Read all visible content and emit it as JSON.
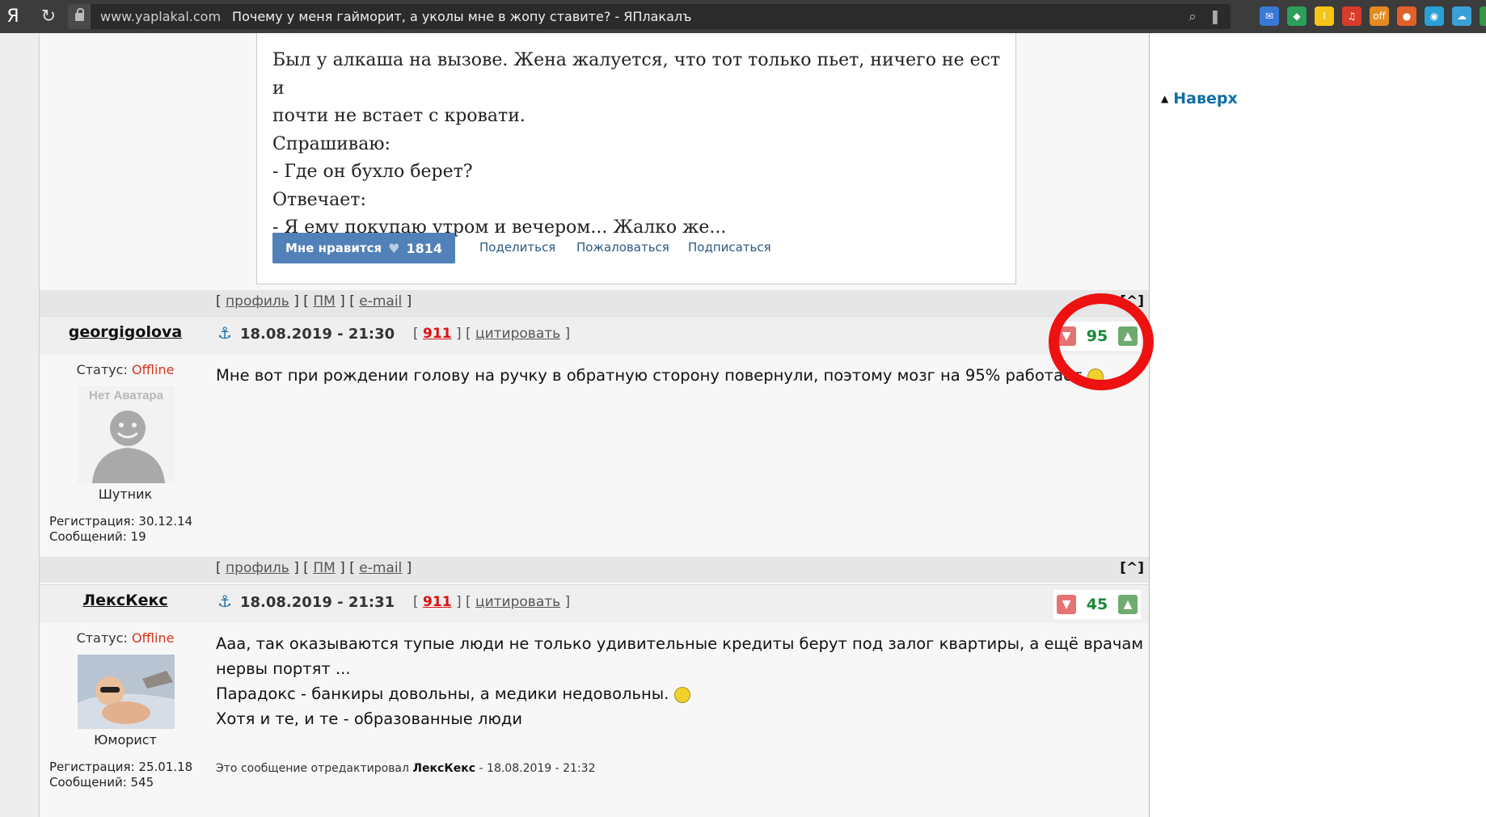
{
  "browser": {
    "logo": "Я",
    "reload_icon": "↻",
    "domain": "www.yaplakal.com",
    "title": "Почему у меня гайморит, а уколы мне в жопу ставите? - ЯПлакалъ",
    "extensions": [
      {
        "name": "mail-extension-icon",
        "color": "#3a78d8",
        "glyph": "✉"
      },
      {
        "name": "shield-extension-icon",
        "color": "#2c9f5a",
        "glyph": "◆"
      },
      {
        "name": "yellow-extension-icon",
        "color": "#f5c518",
        "glyph": "I"
      },
      {
        "name": "music-extension-icon",
        "color": "#d93b2b",
        "glyph": "♫"
      },
      {
        "name": "offer-extension-icon",
        "color": "#e58a1f",
        "glyph": "off"
      },
      {
        "name": "pin-extension-icon",
        "color": "#e0612a",
        "glyph": "●"
      },
      {
        "name": "bug-extension-icon",
        "color": "#2a9fd8",
        "glyph": "◉"
      },
      {
        "name": "cloud-extension-icon",
        "color": "#3aa0d8",
        "glyph": "☁"
      },
      {
        "name": "download-extension-icon",
        "color": "#2f9a48",
        "glyph": "⬇"
      }
    ]
  },
  "right": {
    "top_link": "Наверх"
  },
  "vk": {
    "lines": [
      "Был у алкаша на вызове. Жена жалуется, что тот только пьет, ничего не ест и",
      "почти не встает с кровати.",
      "Спрашиваю:",
      "- Где он бухло берет?",
      "Отвечает:",
      "- Я ему покупаю утром и вечером... Жалко же..."
    ],
    "like_label": "Мне нравится",
    "like_count": "1814",
    "share": "Поделиться",
    "report": "Пожаловаться",
    "subscribe": "Подписаться"
  },
  "bar_links": {
    "profile": "профиль",
    "pm": "ПМ",
    "email": "e-mail",
    "caret": "[^]"
  },
  "posts": [
    {
      "username": "georgigolova",
      "date": "18.08.2019 - 21:30",
      "num": "911",
      "quote": "цитировать",
      "rating": "95",
      "status_label": "Статус:",
      "status": "Offline",
      "avatar_text": "Нет Аватара",
      "rank": "Шутник",
      "reg": "Регистрация: 30.12.14",
      "msgs": "Сообщений: 19",
      "text": "Мне вот при рождении голову на ручку в обратную сторону повернули, поэтому мозг на 95% работает"
    },
    {
      "username": "ЛексКекс",
      "date": "18.08.2019 - 21:31",
      "num": "911",
      "quote": "цитировать",
      "rating": "45",
      "status_label": "Статус:",
      "status": "Offline",
      "rank": "Юморист",
      "reg": "Регистрация: 25.01.18",
      "msgs": "Сообщений: 545",
      "text1": "Ааа, так оказываются тупые люди не только удивительные кредиты берут под залог квартиры, а ещё врачам",
      "text2": "нервы портят ...",
      "text3": "Парадокс - банкиры довольны, а медики недовольны.",
      "text4": "Хотя и те, и те - образованные люди",
      "edited_prefix": "Это сообщение отредактировал",
      "edited_user": "ЛексКекс",
      "edited_time": "- 18.08.2019 - 21:32"
    }
  ]
}
